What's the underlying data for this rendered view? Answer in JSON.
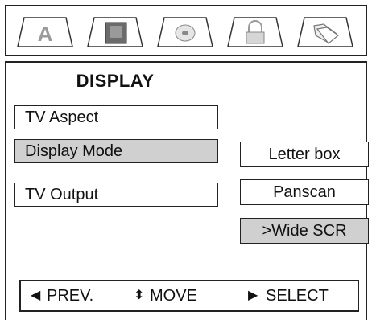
{
  "icons": [
    {
      "name": "audio-icon",
      "glyph": "A",
      "selected": false
    },
    {
      "name": "display-icon",
      "glyph": "",
      "selected": true
    },
    {
      "name": "disc-icon",
      "glyph": "",
      "selected": false
    },
    {
      "name": "lock-icon",
      "glyph": "",
      "selected": false
    },
    {
      "name": "folder-icon",
      "glyph": "",
      "selected": false
    }
  ],
  "menu": {
    "title": "DISPLAY",
    "items": [
      {
        "label": "TV Aspect",
        "selected": false
      },
      {
        "label": "Display Mode",
        "selected": true
      },
      {
        "label": "TV Output",
        "selected": false
      }
    ],
    "options": [
      {
        "label": "Letter box",
        "selected": false
      },
      {
        "label": "Panscan",
        "selected": false
      },
      {
        "label": ">Wide SCR",
        "selected": true
      }
    ]
  },
  "help": {
    "prev": "PREV.",
    "move": "MOVE",
    "select": "SELECT"
  }
}
